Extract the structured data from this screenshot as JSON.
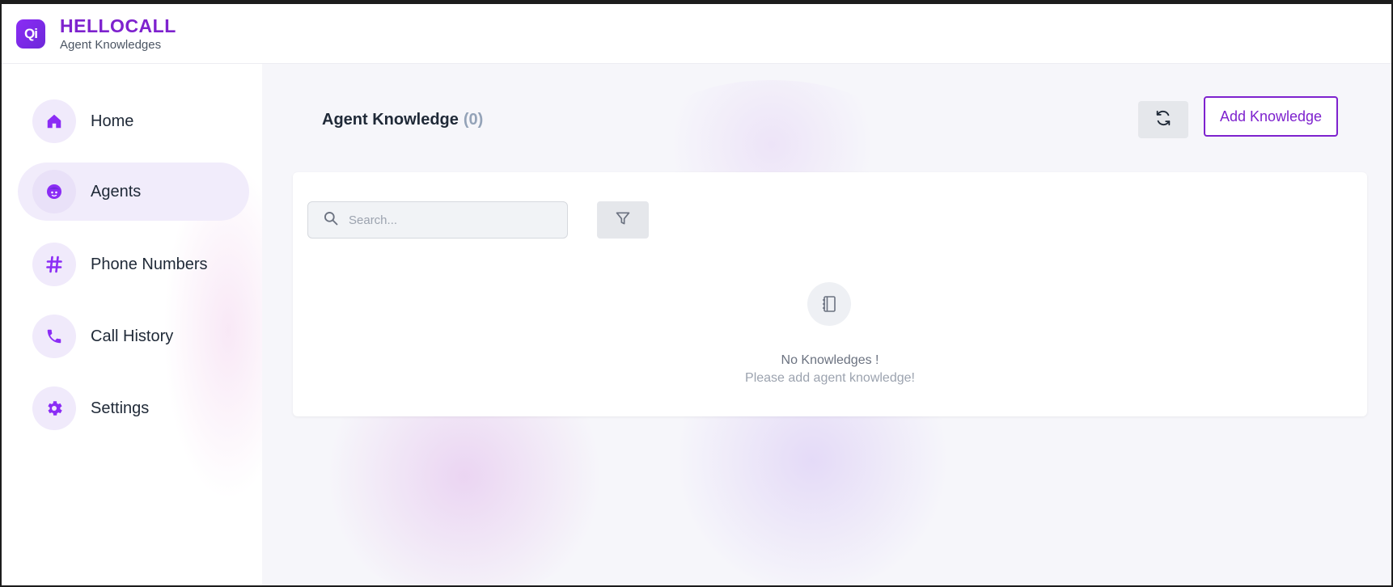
{
  "header": {
    "logo_text": "Qi",
    "brand_name": "HELLOCALL",
    "subtitle": "Agent Knowledges"
  },
  "sidebar": {
    "items": [
      {
        "label": "Home",
        "icon": "home-icon",
        "active": false
      },
      {
        "label": "Agents",
        "icon": "agent-face-icon",
        "active": true
      },
      {
        "label": "Phone Numbers",
        "icon": "hash-icon",
        "active": false
      },
      {
        "label": "Call History",
        "icon": "phone-icon",
        "active": false
      },
      {
        "label": "Settings",
        "icon": "gear-icon",
        "active": false
      }
    ]
  },
  "main": {
    "title": "Agent Knowledge",
    "count": "(0)",
    "refresh_icon": "refresh-icon",
    "add_button_label": "Add Knowledge",
    "search": {
      "placeholder": "Search...",
      "value": ""
    },
    "filter_icon": "filter-icon",
    "empty_state": {
      "icon": "notebook-icon",
      "title": "No Knowledges !",
      "subtitle": "Please add agent knowledge!"
    }
  },
  "colors": {
    "accent": "#7e22ce",
    "nav_icon": "#8b2cf5",
    "active_bg": "#f1ecfb"
  }
}
